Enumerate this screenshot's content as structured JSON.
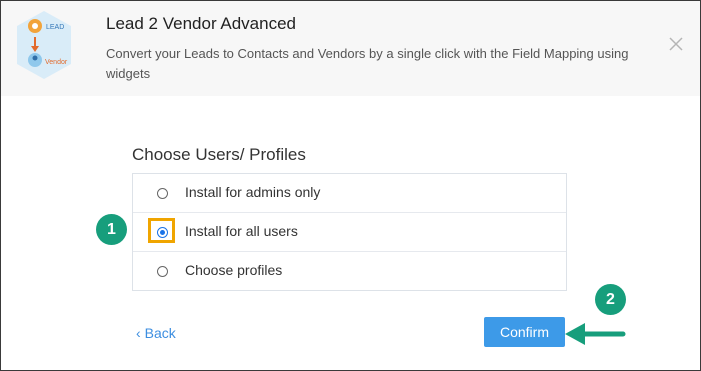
{
  "app": {
    "title": "Lead 2 Vendor Advanced",
    "description": "Convert your Leads to Contacts and Vendors by a single click with the Field Mapping using widgets",
    "logo_labels": {
      "top": "LEAD",
      "bottom": "Vendor"
    }
  },
  "dialog": {
    "section_title": "Choose Users/ Profiles",
    "options": [
      {
        "label": "Install for admins only",
        "selected": false
      },
      {
        "label": "Install for all users",
        "selected": true
      },
      {
        "label": "Choose profiles",
        "selected": false
      }
    ],
    "back_label": "Back",
    "back_icon": "chevron-left-icon",
    "confirm_label": "Confirm"
  },
  "annotations": {
    "step1": "1",
    "step2": "2",
    "colors": {
      "badge": "#179e7c",
      "highlight": "#f0a500",
      "accent": "#3d9ae8"
    }
  },
  "icons": {
    "close": "close-icon"
  }
}
